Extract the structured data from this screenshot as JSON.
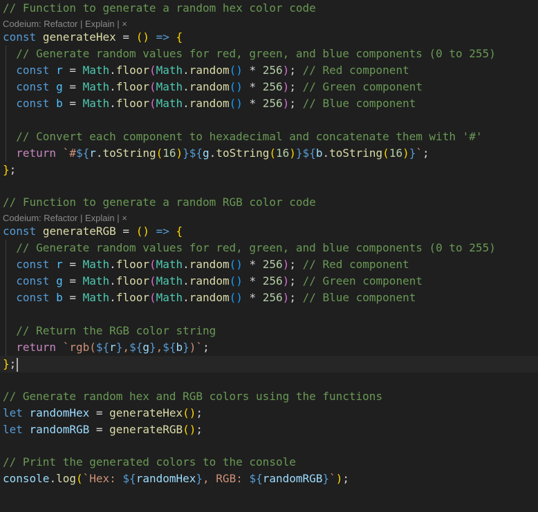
{
  "editor": {
    "codelens_prefix": "Codeium: ",
    "codelens_refactor": "Refactor",
    "codelens_sep": " | ",
    "codelens_explain": "Explain",
    "codelens_close": "×",
    "lines": {
      "l1": "// Function to generate a random hex color code",
      "l2a": "const",
      "l2b": "generateHex",
      "l3": "// Generate random values for red, green, and blue components (0 to 255)",
      "comp_red": "// Red component",
      "comp_green": "// Green component",
      "comp_blue": "// Blue component",
      "l8": "// Convert each component to hexadecimal and concatenate them with '#'",
      "l11": "// Function to generate a random RGB color code",
      "l12b": "generateRGB",
      "l18": "// Return the RGB color string",
      "l22": "// Generate random hex and RGB colors using the functions",
      "l25": "// Print the generated colors to the console"
    }
  }
}
